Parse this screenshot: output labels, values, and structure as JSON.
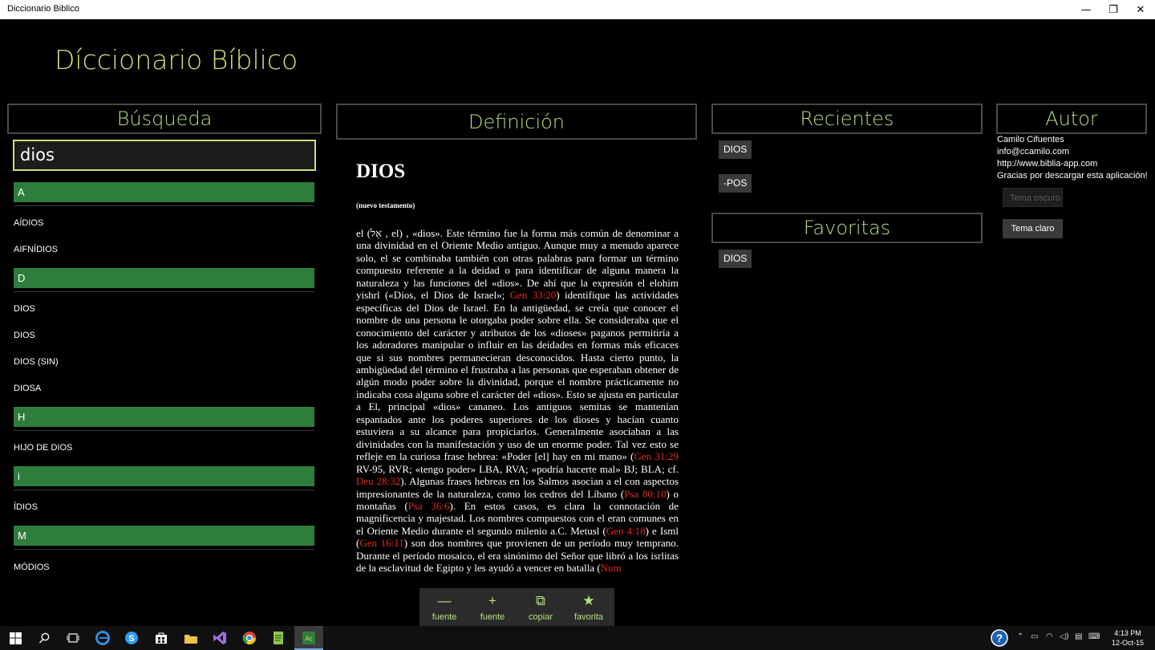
{
  "window": {
    "title": "Diccionario Biblico",
    "minimize": "—",
    "restore": "❐",
    "close": "✕"
  },
  "app": {
    "title": "Díccionario Bíblico"
  },
  "search": {
    "header": "Búsqueda",
    "query": "dios",
    "groups": [
      {
        "letter": "A",
        "items": [
          "AÍDIOS",
          "AIFNÍDIOS"
        ]
      },
      {
        "letter": "D",
        "items": [
          "DIOS",
          "DIOS",
          "DIOS (SIN)",
          "DIOSA"
        ]
      },
      {
        "letter": "H",
        "items": [
          "HIJO DE DIOS"
        ]
      },
      {
        "letter": "i",
        "items": [
          "ÍDIOS"
        ]
      },
      {
        "letter": "M",
        "items": [
          "MÓDIOS"
        ]
      }
    ]
  },
  "definition": {
    "header": "Definición",
    "title": "DIOS",
    "subtitle": "(nuevo testamento)",
    "body": {
      "p1": "el (אֵל , el) , «dios». Este término fue la forma más común de denominar a una divinidad en el Oriente Medio antiguo. Aunque muy a menudo aparece solo, el se combinaba también con otras palabras para formar un término compuesto referente a la deidad o para identificar de alguna manera la naturaleza y las funciones del «dios». De ahí que la expresión el elohim yishrl («Dios, el Dios de Israel»; ",
      "r1": "Gen 33:20",
      "p2": ") identifique las actividades específicas del Dios de Israel. En la antigüedad, se creía que conocer el nombre de una persona le otorgaba poder sobre ella. Se consideraba que el conocimiento del carácter y atributos de los «dioses» paganos permitiría a los adoradores manipular o influir en las deidades en formas más eficaces que si sus nombres permanecieran desconocidos. Hasta cierto punto, la ambigüedad del término el frustraba a las personas que esperaban obtener de algún modo poder sobre la divinidad, porque el nombre prácticamente no indicaba cosa alguna sobre el carácter del «dios». Esto se ajusta en particular a El, principal «dios» cananeo. Los antiguos semitas se mantenían espantados ante los poderes superiores de los dioses y hacían cuanto estuviera a su alcance para propiciarlos. Generalmente asociaban a las divinidades con la manifestación y uso de un enorme poder. Tal vez esto se refleje en la curiosa frase hebrea: «Poder [el] hay en mi mano» (",
      "r2": "Gen 31:29",
      "p3": " RV-95, RVR; «tengo poder» LBA, RVA; «podría hacerte mal» BJ; BLA; cf. ",
      "r3": "Deu 28:32",
      "p4": "). Algunas frases hebreas en los Salmos asocian a el con aspectos impresionantes de la naturaleza, como los cedros del Líbano (",
      "r4": "Psa 80:10",
      "p5": ") o montañas (",
      "r5": "Psa 36:6",
      "p6": "). En estos casos, es clara la connotación de magnificencia y majestad. Los nombres compuestos con el eran comunes en el Oriente Medio durante el segundo milenio a.C. Metusl (",
      "r6": "Gen 4:18",
      "p7": ") e Isml (",
      "r7": "Gen 16:11",
      "p8": ") son dos nombres que provienen de un período muy temprano. Durante el período mosaico, el era sinónimo del Señor que libró a los isrlitas de la esclavitud de Egipto y les ayudó a vencer en batalla (",
      "r8": "Num"
    }
  },
  "commands": [
    {
      "icon": "—",
      "label": "fuente"
    },
    {
      "icon": "+",
      "label": "fuente"
    },
    {
      "icon": "⧉",
      "label": "copiar"
    },
    {
      "icon": "★",
      "label": "favorita"
    }
  ],
  "recientes": {
    "header": "Recientes",
    "items": [
      "DIOS",
      "-POS"
    ]
  },
  "favoritas": {
    "header": "Favoritas",
    "items": [
      "DIOS"
    ]
  },
  "autor": {
    "header": "Autor",
    "name": "Camilo Cifuentes",
    "email": "info@ccamilo.com",
    "web": "http://www.biblia-app.com",
    "thanks": "Gracias por descargar esta aplicación!",
    "dark_theme": "Tema oscuro",
    "light_theme": "Tema claro"
  },
  "taskbar": {
    "time": "4:13 PM",
    "date": "12-Oct-15"
  }
}
